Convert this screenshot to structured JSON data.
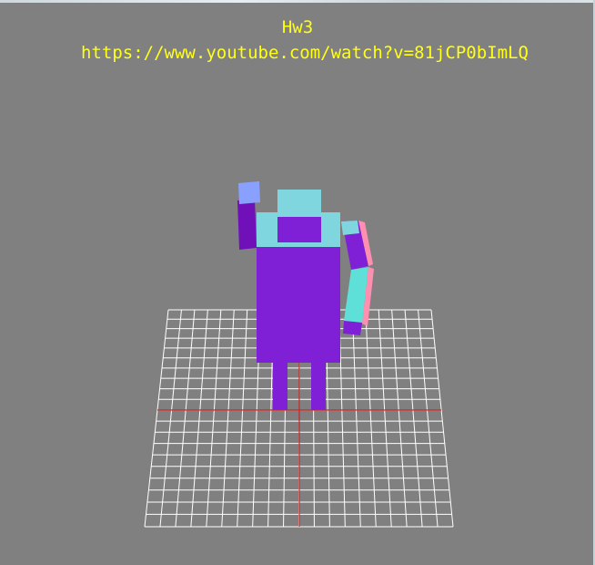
{
  "overlay": {
    "title": "Hw3",
    "url": "https://www.youtube.com/watch?v=81jCP0bImLQ"
  },
  "scene": {
    "background_color": "#808080",
    "grid_color": "#ffffff",
    "axis_color": "#cc2222",
    "body_color": "#7f1fd6",
    "head_color": "#7fd6de",
    "arm_pink_color": "#ff8fb0",
    "hand_blue_color": "#8aa0ff",
    "arm_dark_color": "#6f10b8",
    "text_color": "#ffff1a"
  }
}
